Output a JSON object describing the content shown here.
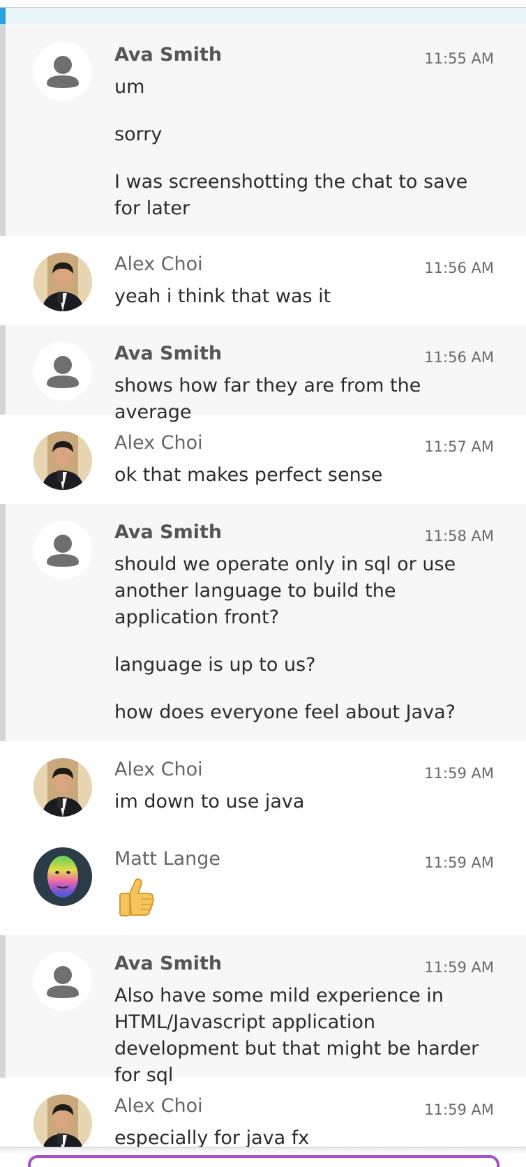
{
  "messages": [
    {
      "sender": "Ava Smith",
      "time": "11:55 AM",
      "avatar": "person-icon",
      "texts": [
        "um",
        "sorry",
        "I was screenshotting the chat to save for later"
      ]
    },
    {
      "sender": "Alex Choi",
      "time": "11:56 AM",
      "avatar": "alex-photo",
      "texts": [
        "yeah i think that was it"
      ]
    },
    {
      "sender": "Ava Smith",
      "time": "11:56 AM",
      "avatar": "person-icon",
      "texts": [
        "shows how far they are from the average"
      ]
    },
    {
      "sender": "Alex Choi",
      "time": "11:57 AM",
      "avatar": "alex-photo",
      "texts": [
        "ok that makes perfect sense"
      ]
    },
    {
      "sender": "Ava Smith",
      "time": "11:58 AM",
      "avatar": "person-icon",
      "texts": [
        "should we operate only in sql or use another language to build the application front?",
        "language is up to us?",
        "how does everyone feel about Java?"
      ]
    },
    {
      "sender": "Alex Choi",
      "time": "11:59 AM",
      "avatar": "alex-photo",
      "texts": [
        "im down to use java"
      ]
    },
    {
      "sender": "Matt Lange",
      "time": "11:59 AM",
      "avatar": "matt-photo",
      "texts": [],
      "emoji": "thumbs-up-icon"
    },
    {
      "sender": "Ava Smith",
      "time": "11:59 AM",
      "avatar": "person-icon",
      "texts": [
        "Also have some mild experience in HTML/Javascript application development but that might be harder for sql"
      ]
    },
    {
      "sender": "Alex Choi",
      "time": "11:59 AM",
      "avatar": "alex-photo",
      "texts": [
        "especially for java fx"
      ]
    }
  ],
  "colors": {
    "self_background": "#f7f7f7",
    "self_accent_bar": "#d6d6d6",
    "top_accent": "#2aa3e0",
    "composer_border": "#a64fc8"
  }
}
